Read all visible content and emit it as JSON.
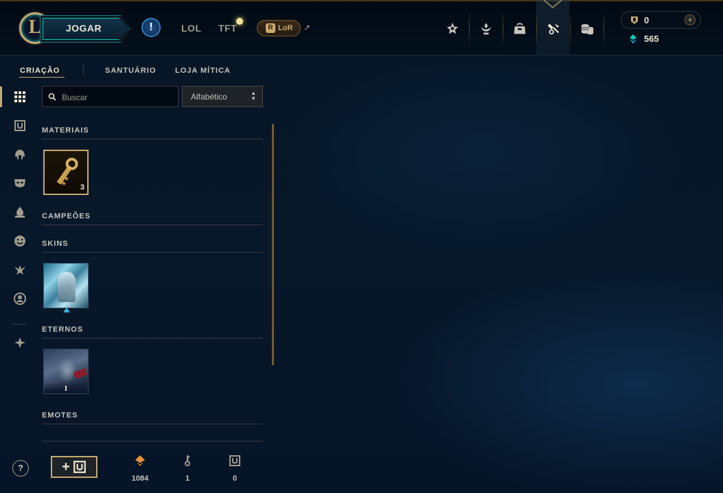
{
  "header": {
    "logo_letter": "L",
    "play_label": "JOGAR",
    "alert_label": "!",
    "game_tabs": [
      "LOL",
      "TFT"
    ],
    "lor_icon_letter": "R",
    "lor_label": "LoR",
    "lor_arrow": "↗",
    "nav_icons": [
      "star-badge-icon",
      "honor-icon",
      "backpack-icon",
      "crafting-hammer-icon",
      "store-coins-icon"
    ],
    "active_nav": "crafting-hammer-icon",
    "rp_value": "0",
    "add_rp_label": "+",
    "be_value": "565",
    "rp_color": "#c8aa6e",
    "be_color": "#0ac8b9"
  },
  "subnav": {
    "tabs": [
      "CRIAÇÃO",
      "SANTUÁRIO",
      "LOJA MÍTICA"
    ],
    "active": "CRIAÇÃO"
  },
  "sidebar": {
    "icons": [
      "grid-icon",
      "chest-icon",
      "helmet-icon",
      "mask-icon",
      "ward-icon",
      "emote-icon",
      "summoner-icon",
      "profile-icon",
      "tft-icon"
    ],
    "active": "grid-icon",
    "help_label": "?"
  },
  "filters": {
    "search_placeholder": "Buscar",
    "search_value": "",
    "sort_value": "Alfabético"
  },
  "categories": {
    "materials": {
      "title": "MATERIAIS",
      "items": [
        {
          "type": "key-fragment",
          "count": "3"
        }
      ]
    },
    "champions": {
      "title": "CAMPEÕES"
    },
    "skins": {
      "title": "SKINS",
      "items": [
        {
          "type": "skin-shard"
        }
      ]
    },
    "eternals": {
      "title": "ETERNOS",
      "items": [
        {
          "type": "eternal-shard",
          "badge": "I"
        }
      ]
    },
    "emotes": {
      "title": "EMOTES"
    }
  },
  "footer": {
    "add_chest_plus": "+",
    "essence_orange": "1084",
    "keys": "1",
    "chests": "0",
    "orange_essence_color": "#e89040"
  }
}
